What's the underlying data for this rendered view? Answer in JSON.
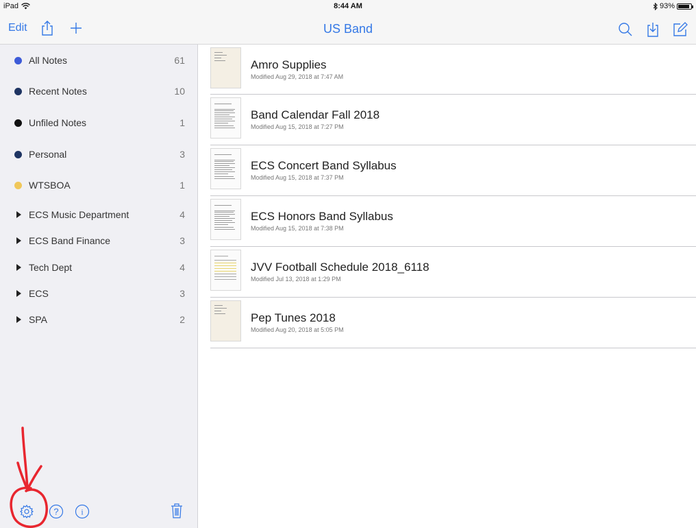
{
  "status": {
    "device": "iPad",
    "time": "8:44 AM",
    "battery": "93%",
    "battery_level": 0.93
  },
  "nav": {
    "edit_label": "Edit",
    "title": "US Band"
  },
  "sidebar": {
    "items": [
      {
        "kind": "dot",
        "color": "#3d5bd8",
        "label": "All Notes",
        "count": "61"
      },
      {
        "kind": "dot",
        "color": "#1e3462",
        "label": "Recent Notes",
        "count": "10"
      },
      {
        "kind": "dot",
        "color": "#111111",
        "label": "Unfiled Notes",
        "count": "1"
      },
      {
        "kind": "dot",
        "color": "#1e3462",
        "label": "Personal",
        "count": "3"
      },
      {
        "kind": "dot",
        "color": "#f0c75a",
        "label": "WTSBOA",
        "count": "1"
      },
      {
        "kind": "group",
        "label": "ECS Music Department",
        "count": "4"
      },
      {
        "kind": "group",
        "label": "ECS Band Finance",
        "count": "3"
      },
      {
        "kind": "group",
        "label": "Tech Dept",
        "count": "4"
      },
      {
        "kind": "group",
        "label": "ECS",
        "count": "3"
      },
      {
        "kind": "group",
        "label": "SPA",
        "count": "2"
      }
    ]
  },
  "notes": [
    {
      "title": "Amro Supplies",
      "modified": "Modified Aug 29, 2018 at 7:47 AM",
      "thumb": "tan"
    },
    {
      "title": "Band Calendar Fall 2018",
      "modified": "Modified Aug 15, 2018 at 7:27 PM",
      "thumb": "doc"
    },
    {
      "title": "ECS Concert Band Syllabus",
      "modified": "Modified Aug 15, 2018 at 7:37 PM",
      "thumb": "doc"
    },
    {
      "title": "ECS Honors Band Syllabus",
      "modified": "Modified Aug 15, 2018 at 7:38 PM",
      "thumb": "doc"
    },
    {
      "title": "JVV Football Schedule 2018_6118",
      "modified": "Modified Jul 13, 2018 at 1:29 PM",
      "thumb": "table"
    },
    {
      "title": "Pep Tunes 2018",
      "modified": "Modified Aug 20, 2018 at 5:05 PM",
      "thumb": "tan"
    }
  ],
  "colors": {
    "accent": "#3478e6",
    "annotation": "#e8262f"
  },
  "icons": [
    "wifi-icon",
    "bluetooth-icon",
    "battery-icon",
    "share-icon",
    "add-icon",
    "search-icon",
    "import-icon",
    "compose-icon",
    "settings-gear-icon",
    "help-icon",
    "info-icon",
    "trash-icon"
  ]
}
